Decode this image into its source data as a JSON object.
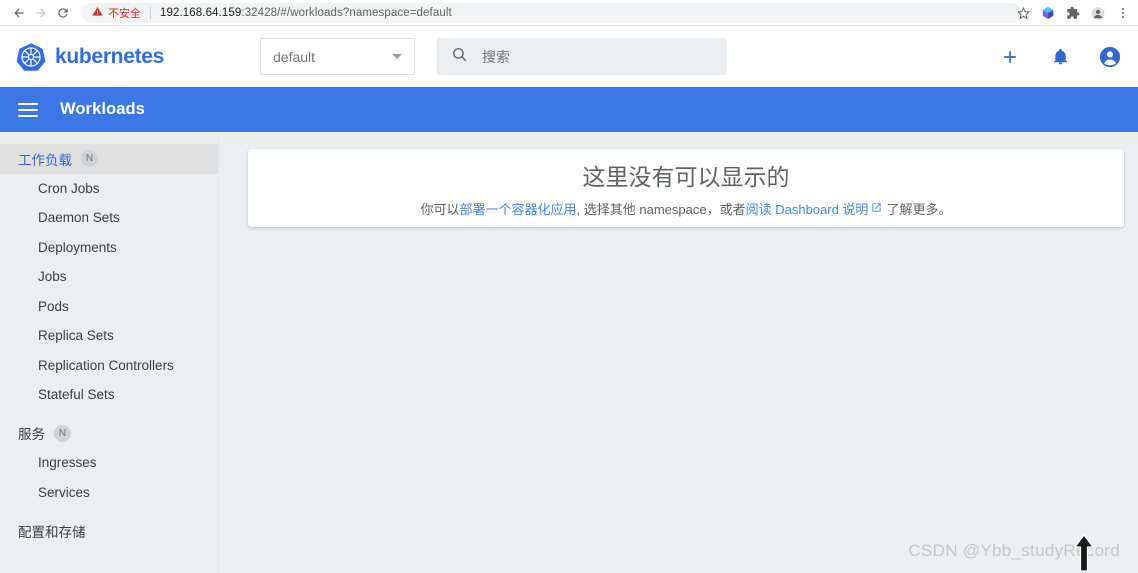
{
  "browser": {
    "back_icon": "back-arrow-icon",
    "forward_icon": "forward-arrow-icon",
    "reload_icon": "reload-icon",
    "security_label": "不安全",
    "url_host": "192.168.64.159",
    "url_rest": ":32428/#/workloads?namespace=default",
    "icons": [
      "star-icon",
      "extension-cube-icon",
      "puzzle-extension-icon",
      "profile-avatar-icon",
      "three-dot-menu-icon"
    ]
  },
  "header": {
    "brand": "kubernetes",
    "logo_icon": "kubernetes-helm-logo",
    "namespace_value": "default",
    "namespace_caret_icon": "chevron-down-icon",
    "search_placeholder": "搜索",
    "search_icon": "search-icon",
    "actions": [
      {
        "name": "create-button",
        "icon": "plus-icon"
      },
      {
        "name": "notifications-button",
        "icon": "bell-icon"
      },
      {
        "name": "account-button",
        "icon": "account-circle-icon"
      }
    ]
  },
  "toolbar": {
    "menu_icon": "hamburger-menu-icon",
    "title": "Workloads",
    "background": "#3b78e7"
  },
  "sidebar": {
    "sections": [
      {
        "label": "工作负载",
        "badge": "N",
        "active": true,
        "items": [
          "Cron Jobs",
          "Daemon Sets",
          "Deployments",
          "Jobs",
          "Pods",
          "Replica Sets",
          "Replication Controllers",
          "Stateful Sets"
        ]
      },
      {
        "label": "服务",
        "badge": "N",
        "active": false,
        "items": [
          "Ingresses",
          "Services"
        ]
      },
      {
        "label": "配置和存储",
        "badge": "",
        "active": false,
        "items": []
      }
    ]
  },
  "main": {
    "empty_title": "这里没有可以显示的",
    "sub_prefix": "你可以 ",
    "sub_link1": "部署一个容器化应用",
    "sub_middle": ", 选择其他 namespace，或者 ",
    "sub_link2": "阅读 Dashboard 说明",
    "sub_external_icon": "external-link-icon",
    "sub_suffix": " 了解更多。"
  },
  "overlay": {
    "watermark": "CSDN @Ybb_studyRecord",
    "cursor_icon": "up-arrow-cursor"
  },
  "colors": {
    "brand_blue": "#326ce5",
    "toolbar_blue": "#3b78e7",
    "link_blue": "#4285f4",
    "page_bg": "#eceff1",
    "warning_red": "#d93025"
  }
}
